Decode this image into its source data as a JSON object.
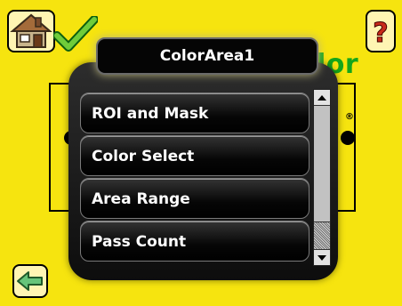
{
  "menu": {
    "title": "ColorArea1",
    "items": [
      {
        "label": "ROI and Mask"
      },
      {
        "label": "Color Select"
      },
      {
        "label": "Area Range"
      },
      {
        "label": "Pass Count"
      }
    ]
  },
  "background": {
    "partial_title": "lor",
    "registered_mark": "®"
  },
  "icons": {
    "home": "home-icon",
    "check": "check-icon",
    "help": "help-icon",
    "back": "back-arrow-icon",
    "scroll_up": "up-arrow-icon",
    "scroll_down": "down-arrow-icon"
  },
  "scrollbar": {
    "position_fraction": 0.92
  },
  "colors": {
    "screen_bg": "#f6e40f",
    "accent_green": "#14a61a",
    "menu_bg": "#000000",
    "menu_text": "#ffffff"
  }
}
